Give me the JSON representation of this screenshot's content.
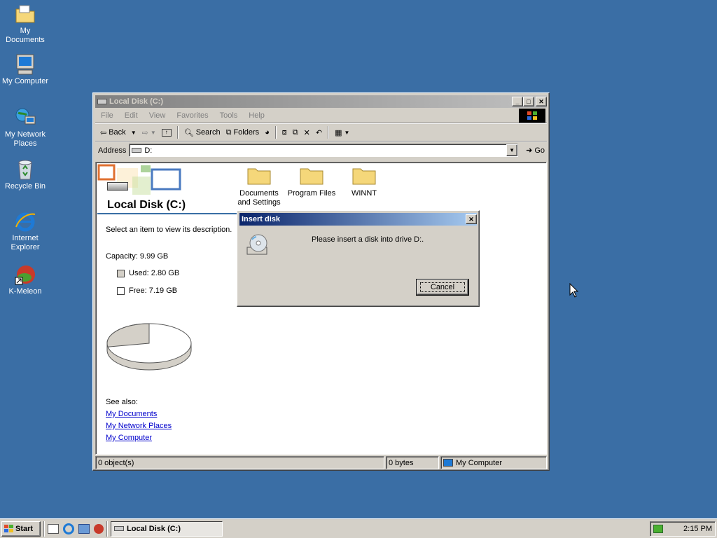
{
  "desktop": {
    "icons": [
      {
        "label": "My Documents"
      },
      {
        "label": "My Computer"
      },
      {
        "label": "My Network Places"
      },
      {
        "label": "Recycle Bin"
      },
      {
        "label": "Internet Explorer"
      },
      {
        "label": "K-Meleon"
      }
    ]
  },
  "window": {
    "title": "Local Disk (C:)",
    "menu": [
      "File",
      "Edit",
      "View",
      "Favorites",
      "Tools",
      "Help"
    ],
    "toolbar": {
      "back": "Back",
      "search": "Search",
      "folders": "Folders"
    },
    "address": {
      "label": "Address",
      "value": "D:",
      "go": "Go"
    },
    "sidebar": {
      "heading": "Local Disk (C:)",
      "description": "Select an item to view its description.",
      "capacity": "Capacity: 9.99 GB",
      "used": "Used: 2.80 GB",
      "free": "Free: 7.19 GB",
      "used_fraction": 0.28,
      "see_also": "See also:",
      "links": [
        "My Documents",
        "My Network Places",
        "My Computer"
      ]
    },
    "folders": [
      {
        "label": "Documents and Settings"
      },
      {
        "label": "Program Files"
      },
      {
        "label": "WINNT"
      }
    ],
    "status": {
      "objects": "0 object(s)",
      "size": "0 bytes",
      "zone": "My Computer"
    }
  },
  "dialog": {
    "title": "Insert disk",
    "message": "Please insert a disk into drive D:.",
    "cancel": "Cancel"
  },
  "taskbar": {
    "start": "Start",
    "task": "Local Disk (C:)",
    "clock": "2:15 PM"
  },
  "colors": {
    "desktop": "#3a6ea5",
    "titlebar_active": "#0a246a",
    "titlebar_inactive": "#808080",
    "face": "#d4d0c8"
  }
}
